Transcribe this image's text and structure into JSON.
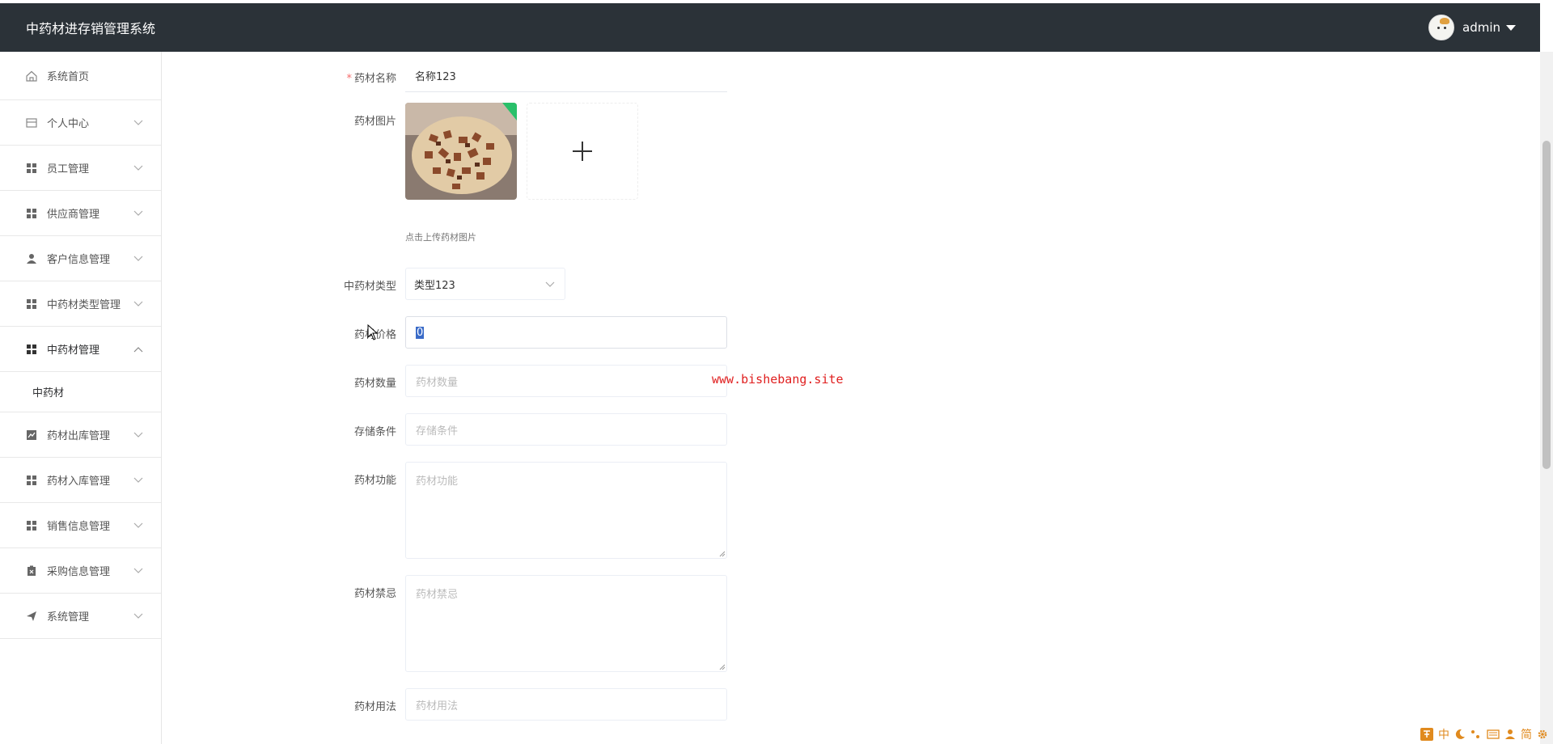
{
  "header": {
    "app_title": "中药材进存销管理系统",
    "user_name": "admin"
  },
  "sidebar": {
    "items": [
      {
        "label": "系统首页",
        "icon": "home-icon"
      },
      {
        "label": "个人中心",
        "icon": "wallet-icon"
      },
      {
        "label": "员工管理",
        "icon": "grid-icon"
      },
      {
        "label": "供应商管理",
        "icon": "grid-icon"
      },
      {
        "label": "客户信息管理",
        "icon": "user-icon"
      },
      {
        "label": "中药材类型管理",
        "icon": "grid-icon"
      },
      {
        "label": "中药材管理",
        "icon": "grid-icon",
        "expanded": true
      },
      {
        "label": "药材出库管理",
        "icon": "chart-icon"
      },
      {
        "label": "药材入库管理",
        "icon": "grid-icon"
      },
      {
        "label": "销售信息管理",
        "icon": "grid-icon"
      },
      {
        "label": "采购信息管理",
        "icon": "clipboard-icon"
      },
      {
        "label": "系统管理",
        "icon": "send-icon"
      }
    ],
    "sub_item": "中药材"
  },
  "form": {
    "name": {
      "label": "药材名称",
      "value": "名称123",
      "required_mark": "*"
    },
    "image": {
      "label": "药材图片",
      "hint": "点击上传药材图片"
    },
    "type": {
      "label": "中药材类型",
      "value": "类型123"
    },
    "price": {
      "label": "药材价格",
      "value": "0"
    },
    "quantity": {
      "label": "药材数量",
      "placeholder": "药材数量"
    },
    "storage": {
      "label": "存储条件",
      "placeholder": "存储条件"
    },
    "function": {
      "label": "药材功能",
      "placeholder": "药材功能"
    },
    "taboo": {
      "label": "药材禁忌",
      "placeholder": "药材禁忌"
    },
    "usage": {
      "label": "药材用法",
      "placeholder": "药材用法"
    }
  },
  "watermark": "www.bishebang.site",
  "ime": {
    "items": [
      "中",
      "简"
    ]
  },
  "colors": {
    "header_bg": "#2b3238",
    "required": "#f56c6c",
    "watermark": "#e02020"
  }
}
